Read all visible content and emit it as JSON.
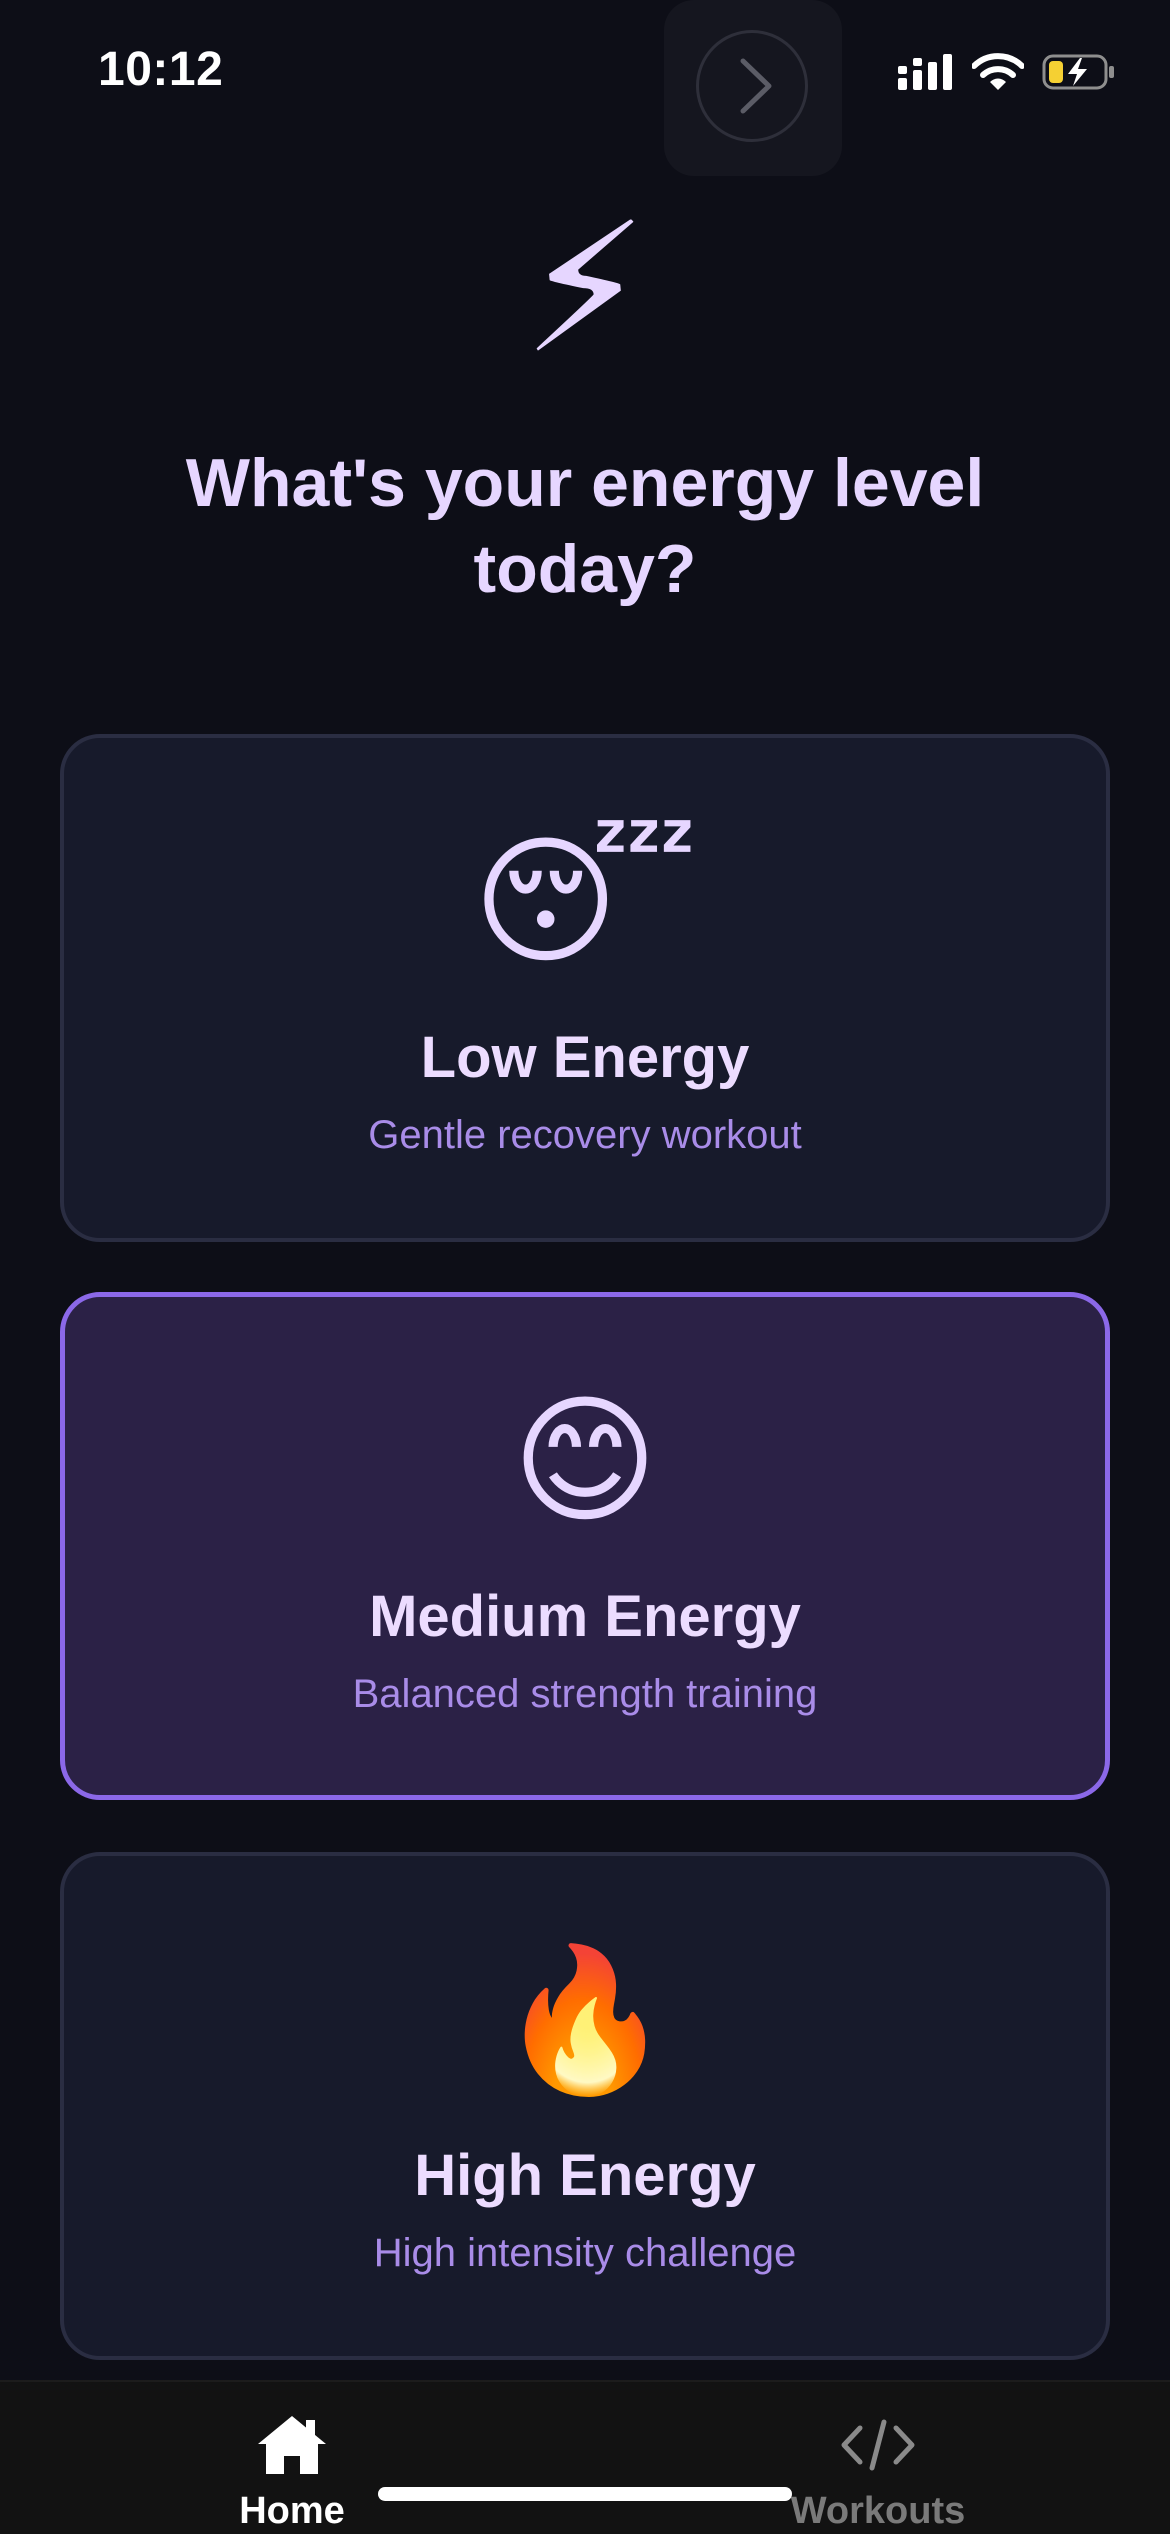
{
  "status_bar": {
    "time": "10:12"
  },
  "hero": {
    "emoji": "⚡",
    "title": "What's your energy level today?"
  },
  "options": [
    {
      "emoji": "😴",
      "title": "Low Energy",
      "subtitle": "Gentle recovery workout",
      "selected": false
    },
    {
      "emoji": "😊",
      "title": "Medium Energy",
      "subtitle": "Balanced strength training",
      "selected": true
    },
    {
      "emoji": "🔥",
      "title": "High Energy",
      "subtitle": "High intensity challenge",
      "selected": false
    }
  ],
  "tabbar": {
    "home_label": "Home",
    "workouts_label": "Workouts",
    "active_tab": "Home"
  },
  "colors": {
    "background": "#0d0e17",
    "card": "#171a2b",
    "card_selected": "#2b2146",
    "accent": "#8b68e8",
    "title_text": "#e6d6ff",
    "subtitle_text": "#a98ce8"
  },
  "icons": {
    "forward": "chevron-right-icon",
    "signal": "cellular-signal-icon",
    "wifi": "wifi-icon",
    "battery": "battery-charging-icon",
    "home_tab": "house-icon",
    "workouts_tab": "code-brackets-icon"
  }
}
